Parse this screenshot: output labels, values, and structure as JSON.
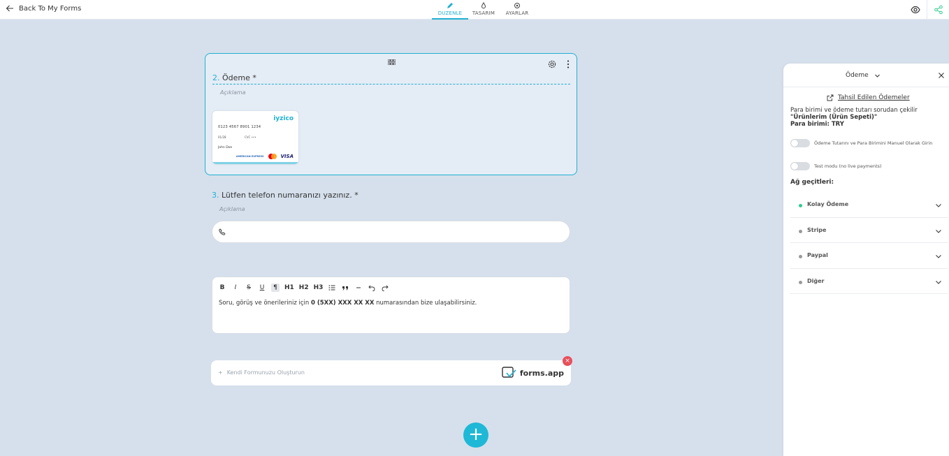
{
  "topbar": {
    "back_label": "Back To My Forms",
    "tabs": [
      {
        "label": "DUZENLE",
        "icon": "pencil-icon",
        "active": true
      },
      {
        "label": "TASARIM",
        "icon": "drop-icon",
        "active": false
      },
      {
        "label": "AYARLAR",
        "icon": "gear-icon",
        "active": false
      }
    ]
  },
  "question2": {
    "number": "2.",
    "title": "Ödeme *",
    "description": "Açıklama",
    "card": {
      "brand": "iyzico",
      "number": "0123 4567 8901 1234",
      "expiry": "01/28",
      "cvv_label": "CVC",
      "cvv": "•••",
      "name": "John Doe",
      "amex": "AMERICAN EXPRESS",
      "visa": "VISA"
    }
  },
  "question3": {
    "number": "3.",
    "title": "Lütfen telefon numaranızı yazınız. *",
    "description": "Açıklama"
  },
  "richtext": {
    "toolbar": [
      "B",
      "I",
      "S",
      "U",
      "¶",
      "H1",
      "H2",
      "H3"
    ],
    "text_before": "Soru, görüş ve önerileriniz için ",
    "text_bold": "0 (5XX) XXX XX XX",
    "text_after": " numarasından bize ulaşabilirsiniz."
  },
  "branding": {
    "cta": "Kendi Formunuzu Oluşturun",
    "logo_text": "forms.app",
    "close": "×"
  },
  "add_button": "+",
  "panel": {
    "title": "Ödeme",
    "paid_link": "Tahsil Edilen Ödemeler",
    "info_line1": "Para birimi ve ödeme tutarı sorudan çekilir",
    "info_line2": "\"Ürünlerim (Ürün Sepeti)\"",
    "info_line3": "Para birimi: TRY",
    "toggle_manual": "Ödeme Tutarını ve Para Birimini Manuel Olarak Girin",
    "toggle_test": "Test modu (no live payments)",
    "gateways_title": "Ağ geçitleri:",
    "gateways": [
      {
        "label": "Kolay Ödeme",
        "active": true
      },
      {
        "label": "Stripe",
        "active": false
      },
      {
        "label": "Paypal",
        "active": false
      },
      {
        "label": "Diğer",
        "active": false
      }
    ]
  },
  "colors": {
    "accent": "#1fb0d1",
    "background": "#d6e0ec",
    "danger": "#e8505b",
    "gateway_active": "#2ecc8f"
  }
}
